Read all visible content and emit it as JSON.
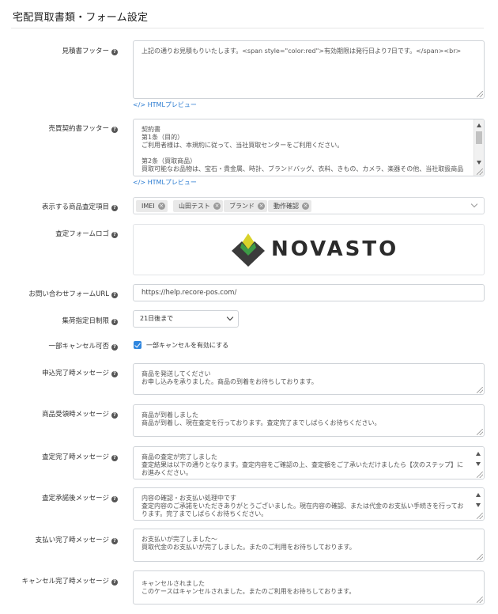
{
  "page": {
    "title": "宅配買取書類・フォーム設定"
  },
  "form": {
    "estimate_footer": {
      "label": "見積書フッター",
      "value": "上記の通りお見積もりいたします。<span style=\"color:red\">有効期限は発行日より7日です。</span><br>",
      "preview_link": "</> HTMLプレビュー"
    },
    "contract_footer": {
      "label": "売買契約書フッター",
      "lines": [
        "契約書",
        "第1条（目的）",
        "ご利用者様は、本規約に従って、当社買取センターをご利用ください。",
        "",
        "第2条（買取商品）",
        "買取可能なお品物は、宝石・貴金属、時計、ブランドバッグ、衣料、きもの、カメラ、楽器その他、当社取扱商品"
      ],
      "preview_link": "</> HTMLプレビュー"
    },
    "display_items": {
      "label": "表示する商品査定項目",
      "tags": [
        "IMEI",
        "山田テスト",
        "ブランド",
        "動作確認"
      ]
    },
    "form_logo": {
      "label": "査定フォームロゴ",
      "logo_text": "NOVASTO"
    },
    "contact_url": {
      "label": "お問い合わせフォームURL",
      "value": "https://help.recore-pos.com/"
    },
    "pickup_limit": {
      "label": "集荷指定日制限",
      "selected": "21日後まで"
    },
    "partial_cancel": {
      "label": "一部キャンセル可否",
      "checkbox_label": "一部キャンセルを有効にする",
      "checked": true
    },
    "messages": [
      {
        "key": "apply_done",
        "label": "申込完了時メッセージ",
        "lines": [
          "商品を発送してください",
          "お申し込みを承りました。商品の到着をお待ちしております。"
        ],
        "scroll": false
      },
      {
        "key": "received",
        "label": "商品受領時メッセージ",
        "lines": [
          "商品が到着しました",
          "商品が到着し、現在査定を行っております。査定完了までしばらくお待ちください。"
        ],
        "scroll": false
      },
      {
        "key": "assess_done",
        "label": "査定完了時メッセージ",
        "lines": [
          "商品の査定が完了しました",
          "査定結果は以下の通りとなります。査定内容をご確認の上、査定額をご了承いただけましたら【次のステップ】にお進みください。"
        ],
        "scroll": true
      },
      {
        "key": "approved",
        "label": "査定承諾後メッセージ",
        "lines": [
          "内容の確認・お支払い処理中です",
          "査定内容のご承諾をいただきありがとうございました。現在内容の確認、または代金のお支払い手続きを行っております。完了までしばらくお待ちください。"
        ],
        "scroll": true
      },
      {
        "key": "paid",
        "label": "支払い完了時メッセージ",
        "lines": [
          "お支払いが完了しました〜",
          "買取代金のお支払いが完了しました。またのご利用をお待ちしております。"
        ],
        "scroll": false
      },
      {
        "key": "cancel",
        "label": "キャンセル完了時メッセージ",
        "lines": [
          "キャンセルされました",
          "このケースはキャンセルされました。またのご利用をお待ちしております。"
        ],
        "scroll": false
      }
    ]
  },
  "colors": {
    "accent": "#2f86de",
    "link": "#2a7bd1",
    "logo_green": "#3d9b46",
    "logo_yellow": "#d8d22a",
    "logo_dark": "#3b3b3b"
  }
}
